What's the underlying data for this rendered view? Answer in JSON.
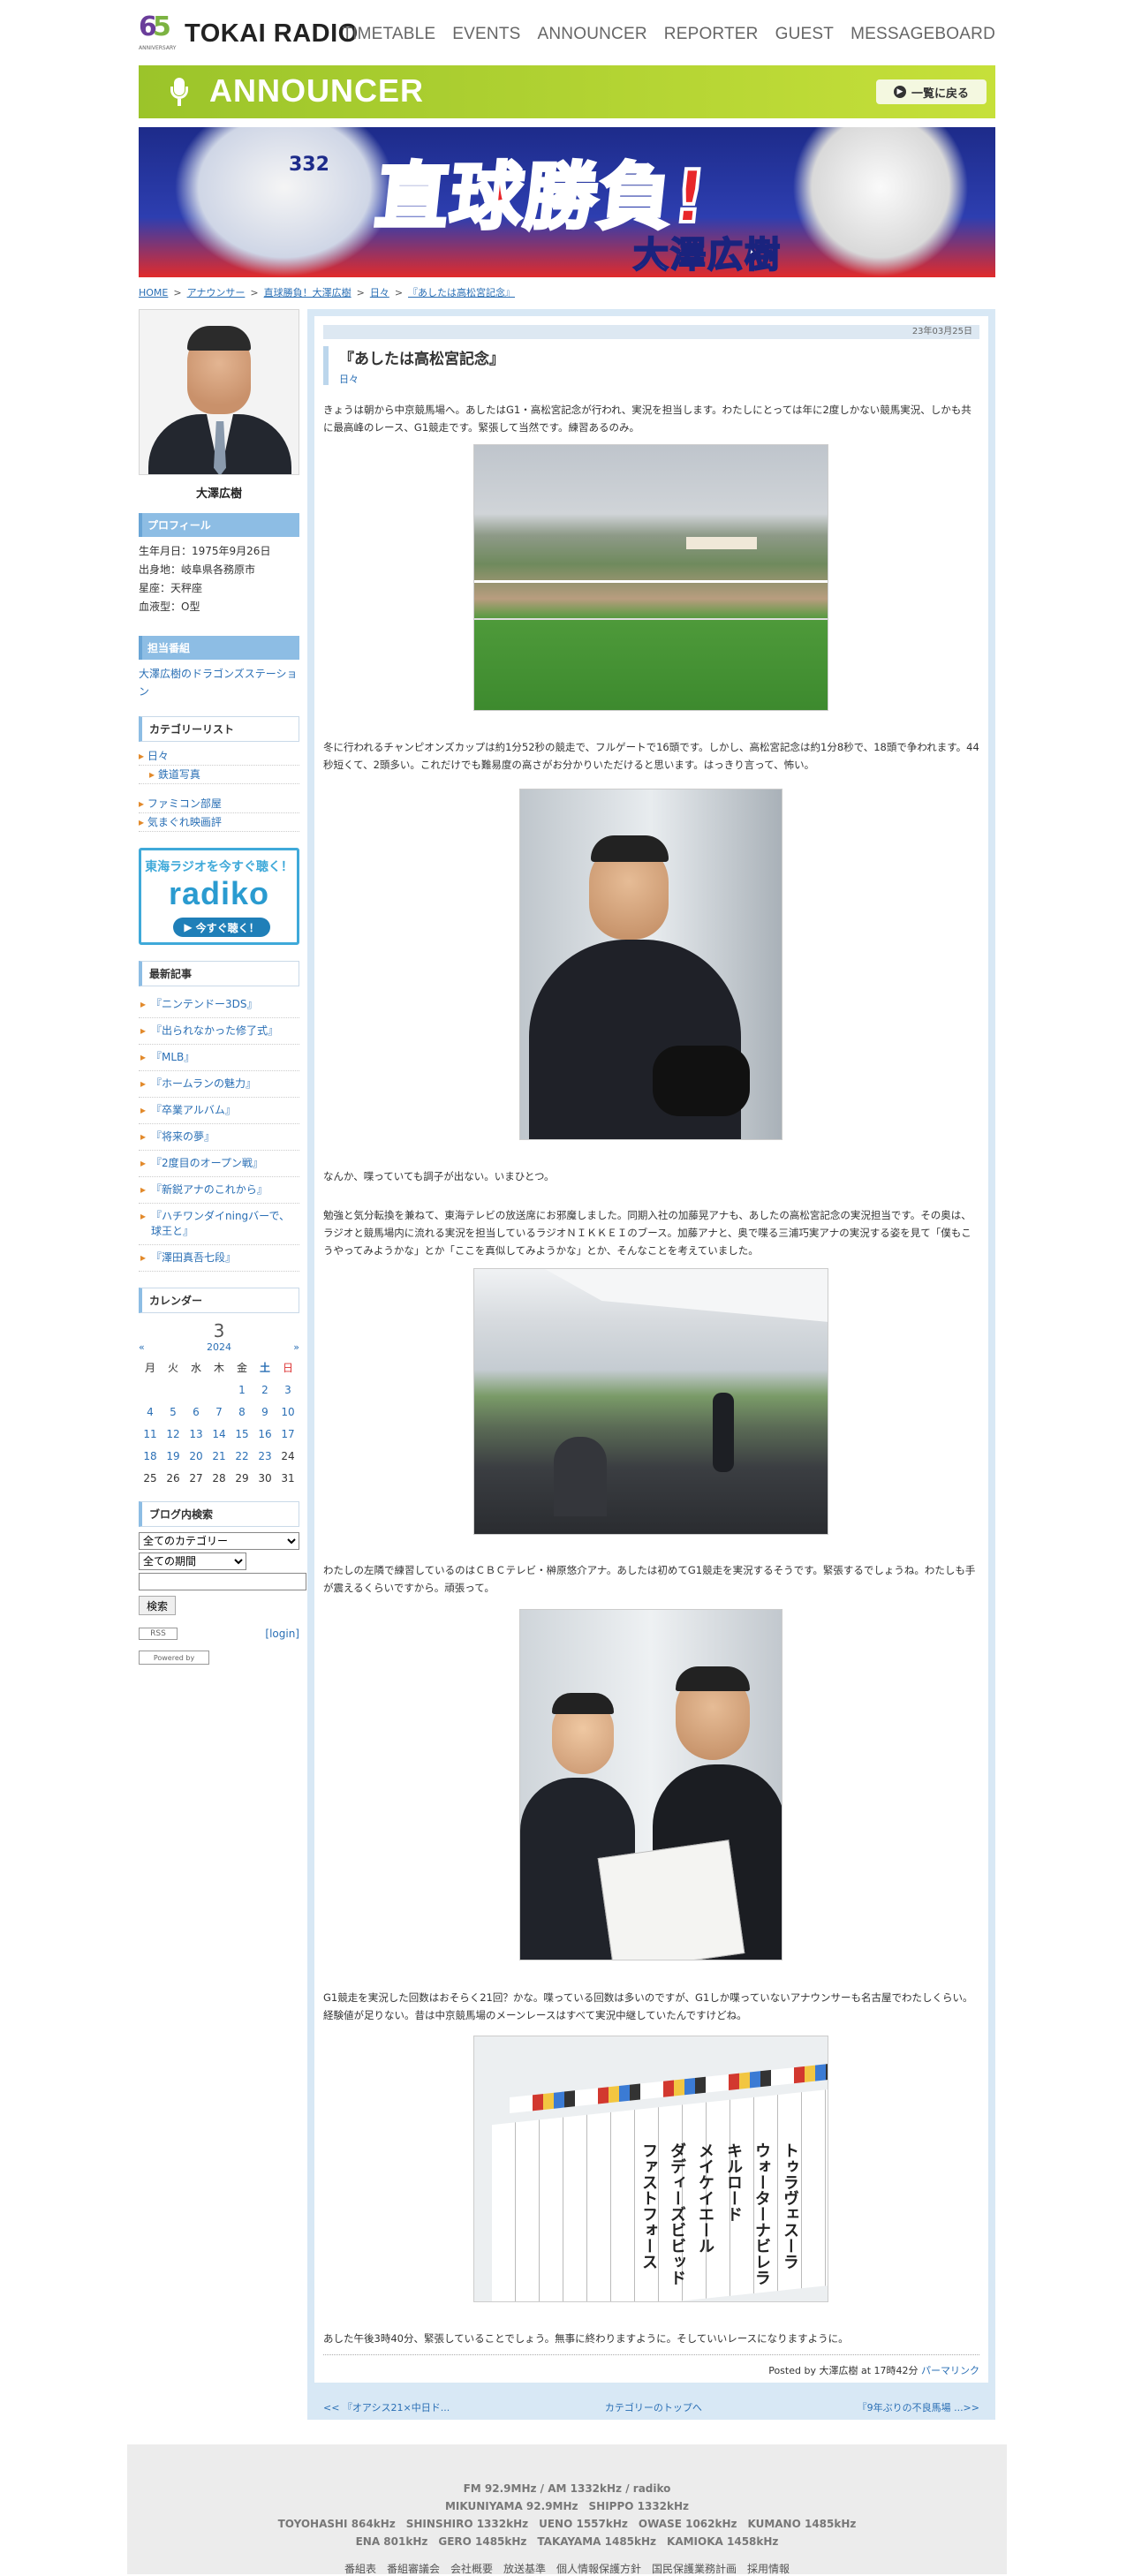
{
  "header": {
    "logo_text": "TOKAI RADIO",
    "nav": [
      "TIMETABLE",
      "EVENTS",
      "ANNOUNCER",
      "REPORTER",
      "GUEST",
      "MESSAGEBOARD"
    ]
  },
  "banner": {
    "title": "ANNOUNCER",
    "back_label": "一覧に戻る",
    "hero_headline": "直球勝負!",
    "hero_name": "大澤広樹",
    "hero_jersey": "332"
  },
  "breadcrumb": [
    "HOME",
    "アナウンサー",
    "直球勝負！大澤広樹",
    "日々",
    "『あしたは高松宮記念』"
  ],
  "sidebar": {
    "profile_name": "大澤広樹",
    "profile_heading": "プロフィール",
    "profile_lines": [
      "生年月日：1975年9月26日",
      "出身地：岐阜県各務原市",
      "星座：天秤座",
      "血液型：O型"
    ],
    "program_heading": "担当番組",
    "program_link": "大澤広樹のドラゴンズステーション",
    "category_heading": "カテゴリーリスト",
    "categories": [
      {
        "label": "日々",
        "sub": false
      },
      {
        "label": "鉄道写真",
        "sub": true
      }
    ],
    "categories2": [
      "ファミコン部屋",
      "気まぐれ映画評"
    ],
    "radiko": {
      "line1": "東海ラジオを今すぐ聴く！",
      "logo": "radiko",
      "btn": "今すぐ聴く！"
    },
    "recent_heading": "最新記事",
    "recent": [
      "『ニンテンドー3DS』",
      "『出られなかった修了式』",
      "『MLB』",
      "『ホームランの魅力』",
      "『卒業アルバム』",
      "『将来の夢』",
      "『2度目のオープン戦』",
      "『新鋭アナのこれから』",
      "『ハチワンダイningバーで、球王と』",
      "『澤田真吾七段』"
    ],
    "calendar_heading": "カレンダー",
    "calendar": {
      "month": "3",
      "prev": "«",
      "year": "2024",
      "next": "»",
      "weekdays": [
        "月",
        "火",
        "水",
        "木",
        "金",
        "土",
        "日"
      ],
      "rows": [
        [
          "",
          "",
          "",
          "",
          "1",
          "2",
          "3"
        ],
        [
          "4",
          "5",
          "6",
          "7",
          "8",
          "9",
          "10"
        ],
        [
          "11",
          "12",
          "13",
          "14",
          "15",
          "16",
          "17"
        ],
        [
          "18",
          "19",
          "20",
          "21",
          "22",
          "23",
          "24"
        ],
        [
          "25",
          "26",
          "27",
          "28",
          "29",
          "30",
          "31"
        ]
      ]
    },
    "search_heading": "ブログ内検索",
    "search_cat": "全てのカテゴリー",
    "search_period": "全ての期間",
    "search_btn": "検索",
    "rss": "RSS",
    "login": "[login]",
    "powered": "Powered by"
  },
  "post": {
    "date": "23年03月25日",
    "title": "『あしたは高松宮記念』",
    "category": "日々",
    "para1": "きょうは朝から中京競馬場へ。あしたはG1・高松宮記念が行われ、実況を担当します。わたしにとっては年に2度しかない競馬実況、しかも共に最高峰のレース、G1競走です。緊張して当然です。練習あるのみ。",
    "para2": "冬に行われるチャンピオンズカップは約1分52秒の競走で、フルゲートで16頭です。しかし、高松宮記念は約1分8秒で、18頭で争われます。44秒短くて、2頭多い。これだけでも難易度の高さがお分かりいただけると思います。はっきり言って、怖い。",
    "para3": "なんか、喋っていても調子が出ない。いまひとつ。",
    "para4": "勉強と気分転換を兼ねて、東海テレビの放送席にお邪魔しました。同期入社の加藤晃アナも、あしたの高松宮記念の実況担当です。その奥は、ラジオと競馬場内に流れる実況を担当しているラジオＮＩＫＫＥＩのブース。加藤アナと、奥で喋る三浦巧実アナの実況する姿を見て「僕もこうやってみようかな」とか「ここを真似してみようかな」とか、そんなことを考えていました。",
    "para5": "わたしの左隣で練習しているのはＣＢＣテレビ・榊原悠介アナ。あしたは初めてG1競走を実況するそうです。緊張するでしょうね。わたしも手が震えるくらいですから。頑張って。",
    "para6": "G1競走を実況した回数はおそらく21回？かな。喋っている回数は多いのですが、G1しか喋っていないアナウンサーも名古屋でわたしくらい。経験値が足りない。昔は中京競馬場のメーンレースはすべて実況中継していたんですけどね。",
    "para7": "あした午後3時40分、緊張していることでしょう。無事に終わりますように。そしていいレースになりますように。",
    "board_labels": [
      "トゥラヴェスーラ",
      "ウォーターナビレラ",
      "キルロード",
      "メイケイエール",
      "ダディーズビビッド",
      "ファストフォース"
    ],
    "posted_by": "Posted by 大澤広樹 at 17時42分",
    "permalink": "パーマリンク"
  },
  "pager": {
    "prev": "<< 『オアシス21×中日ド...",
    "top": "カテゴリーのトップへ",
    "next": "『9年ぶりの不良馬場 ...>>"
  },
  "footer": {
    "l1": "FM 92.9MHz / AM 1332kHz / radiko",
    "l2": "MIKUNIYAMA 92.9MHz　SHIPPO 1332kHz",
    "l3": "TOYOHASHI 864kHz　SHINSHIRO 1332kHz　UENO 1557kHz　OWASE 1062kHz　KUMANO 1485kHz",
    "l4": "ENA 801kHz　GERO 1485kHz　TAKAYAMA 1485kHz　KAMIOKA 1458kHz",
    "links": "番組表　番組審議会　会社概要　放送基準　個人情報保護方針　国民保護業務計画　採用情報"
  }
}
